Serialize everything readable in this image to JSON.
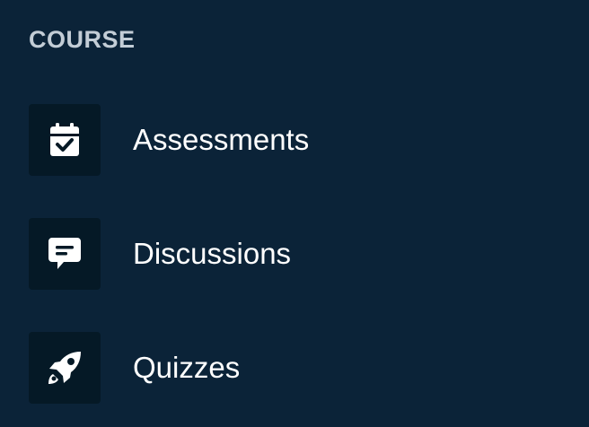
{
  "sidebar": {
    "section_title": "COURSE",
    "items": [
      {
        "label": "Assessments",
        "icon": "calendar-check-icon"
      },
      {
        "label": "Discussions",
        "icon": "chat-bubble-icon"
      },
      {
        "label": "Quizzes",
        "icon": "rocket-icon"
      }
    ]
  },
  "colors": {
    "background": "#0b2338",
    "icon_tile": "#051926",
    "label_text": "#ffffff",
    "section_title": "#c3cdd6"
  }
}
